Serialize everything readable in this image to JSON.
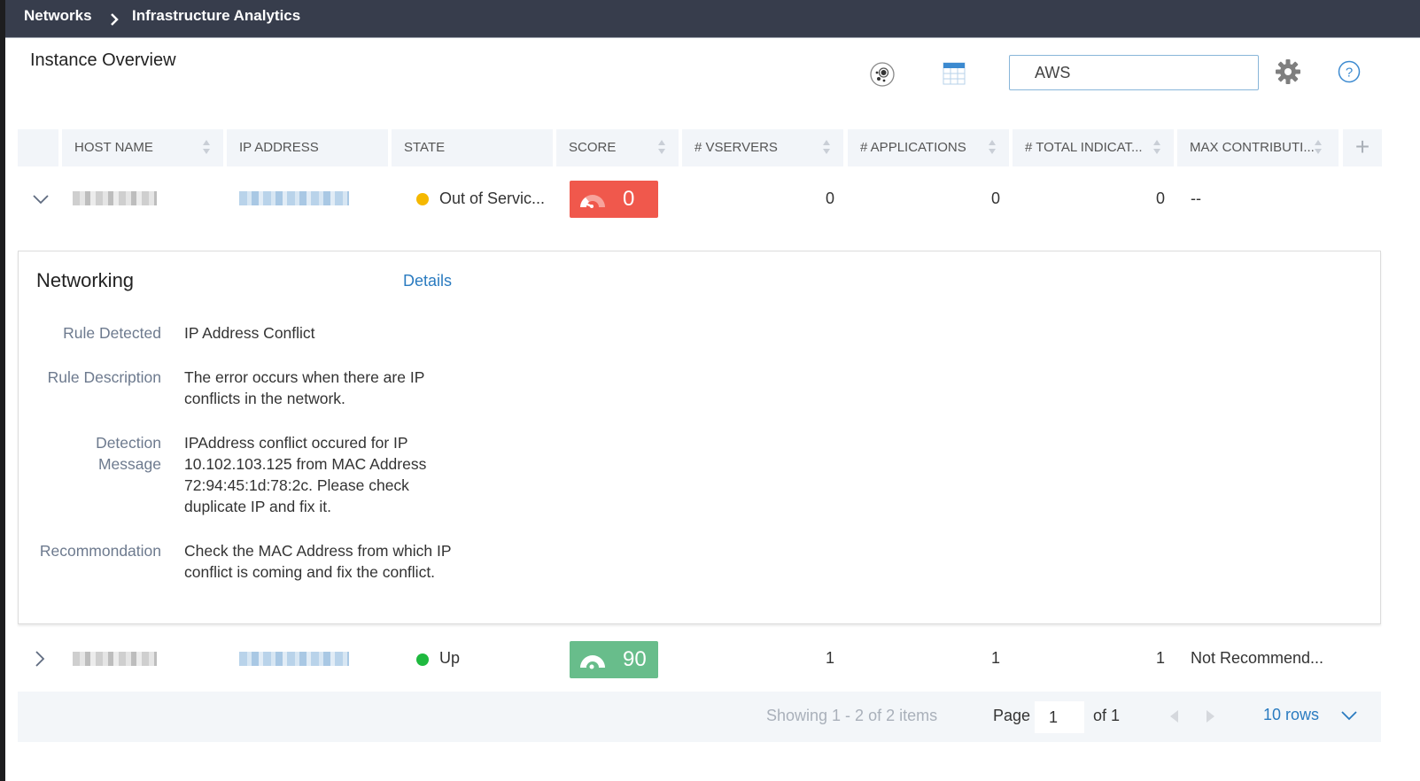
{
  "breadcrumb": {
    "items": [
      "Networks",
      "Infrastructure Analytics"
    ],
    "separator": ">"
  },
  "page": {
    "title": "Instance Overview"
  },
  "toolbar": {
    "icons": [
      "bubble-view-icon",
      "table-view-icon",
      "gear-icon",
      "help-icon"
    ],
    "search": {
      "value": "AWS",
      "placeholder": ""
    }
  },
  "table": {
    "columns": [
      "HOST NAME",
      "IP ADDRESS",
      "STATE",
      "SCORE",
      "# VSERVERS",
      "# APPLICATIONS",
      "# TOTAL INDICAT...",
      "MAX CONTRIBUTI..."
    ],
    "add_column_label": "+",
    "rows": [
      {
        "expanded": true,
        "host": "[redacted]",
        "ip": "[redacted]",
        "state": "Out of Servic...",
        "state_color": "#f5b800",
        "score": "0",
        "score_color": "#f0584c",
        "vservers": "0",
        "applications": "0",
        "total_indicators": "0",
        "max_contributor": "--"
      },
      {
        "expanded": false,
        "host": "[redacted]",
        "ip": "[redacted]",
        "state": "Up",
        "state_color": "#1fb93f",
        "score": "90",
        "score_color": "#68bd8b",
        "vservers": "1",
        "applications": "1",
        "total_indicators": "1",
        "max_contributor": "Not Recommend..."
      }
    ]
  },
  "detail": {
    "title": "Networking",
    "details_link": "Details",
    "fields": [
      {
        "label": "Rule Detected",
        "value": "IP Address Conflict"
      },
      {
        "label": "Rule Description",
        "value": "The error occurs when there are IP conflicts in the network."
      },
      {
        "label": "Detection Message",
        "value": "IPAddress conflict occured for IP 10.102.103.125 from MAC Address 72:94:45:1d:78:2c. Please check duplicate IP and fix it."
      },
      {
        "label": "Recommondation",
        "value": "Check the MAC Address from which IP conflict is coming and fix the conflict."
      }
    ]
  },
  "pagination": {
    "showing": "Showing 1 - 2 of 2 items",
    "page_label": "Page",
    "page_value": "1",
    "of_label": "of 1",
    "rows_label": "10 rows"
  },
  "colors": {
    "accent": "#2a7bc0",
    "topbar": "#373d4c",
    "header_bg": "#f2f5f9"
  }
}
